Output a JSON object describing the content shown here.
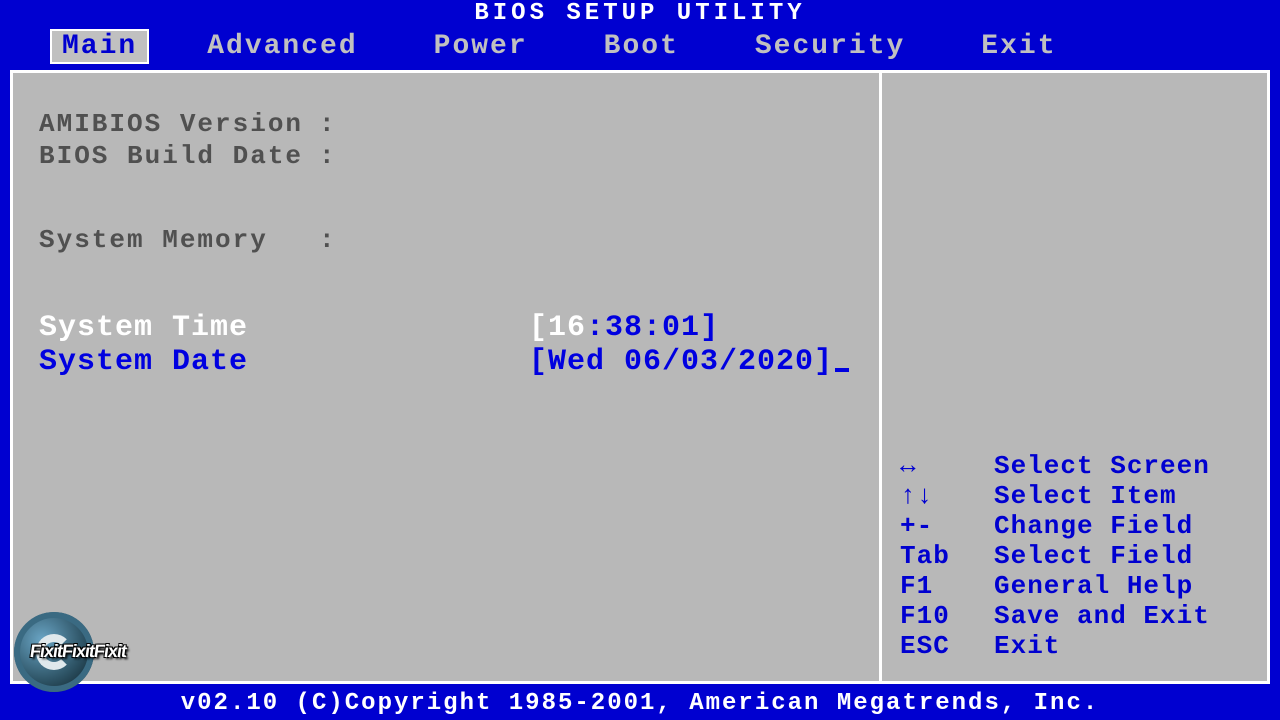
{
  "title": "BIOS SETUP UTILITY",
  "tabs": [
    "Main",
    "Advanced",
    "Power",
    "Boot",
    "Security",
    "Exit"
  ],
  "active_tab_index": 0,
  "info": {
    "amibios_version_label": "AMIBIOS Version",
    "amibios_version_value": "",
    "bios_build_date_label": "BIOS Build Date",
    "bios_build_date_value": "",
    "system_memory_label": "System Memory",
    "system_memory_value": ""
  },
  "time": {
    "label": "System Time",
    "hour": "16",
    "rest": ":38:01"
  },
  "date": {
    "label": "System Date",
    "value": "[Wed 06/03/2020]"
  },
  "help": [
    {
      "key": "↔",
      "action": "Select Screen"
    },
    {
      "key": "↑↓",
      "action": "Select Item"
    },
    {
      "key": "+-",
      "action": "Change Field"
    },
    {
      "key": "Tab",
      "action": "Select Field"
    },
    {
      "key": "F1",
      "action": "General Help"
    },
    {
      "key": "F10",
      "action": "Save and Exit"
    },
    {
      "key": "ESC",
      "action": "Exit"
    }
  ],
  "footer": "v02.10 (C)Copyright 1985-2001, American Megatrends, Inc.",
  "watermark_text": "FixitFixitFixit"
}
